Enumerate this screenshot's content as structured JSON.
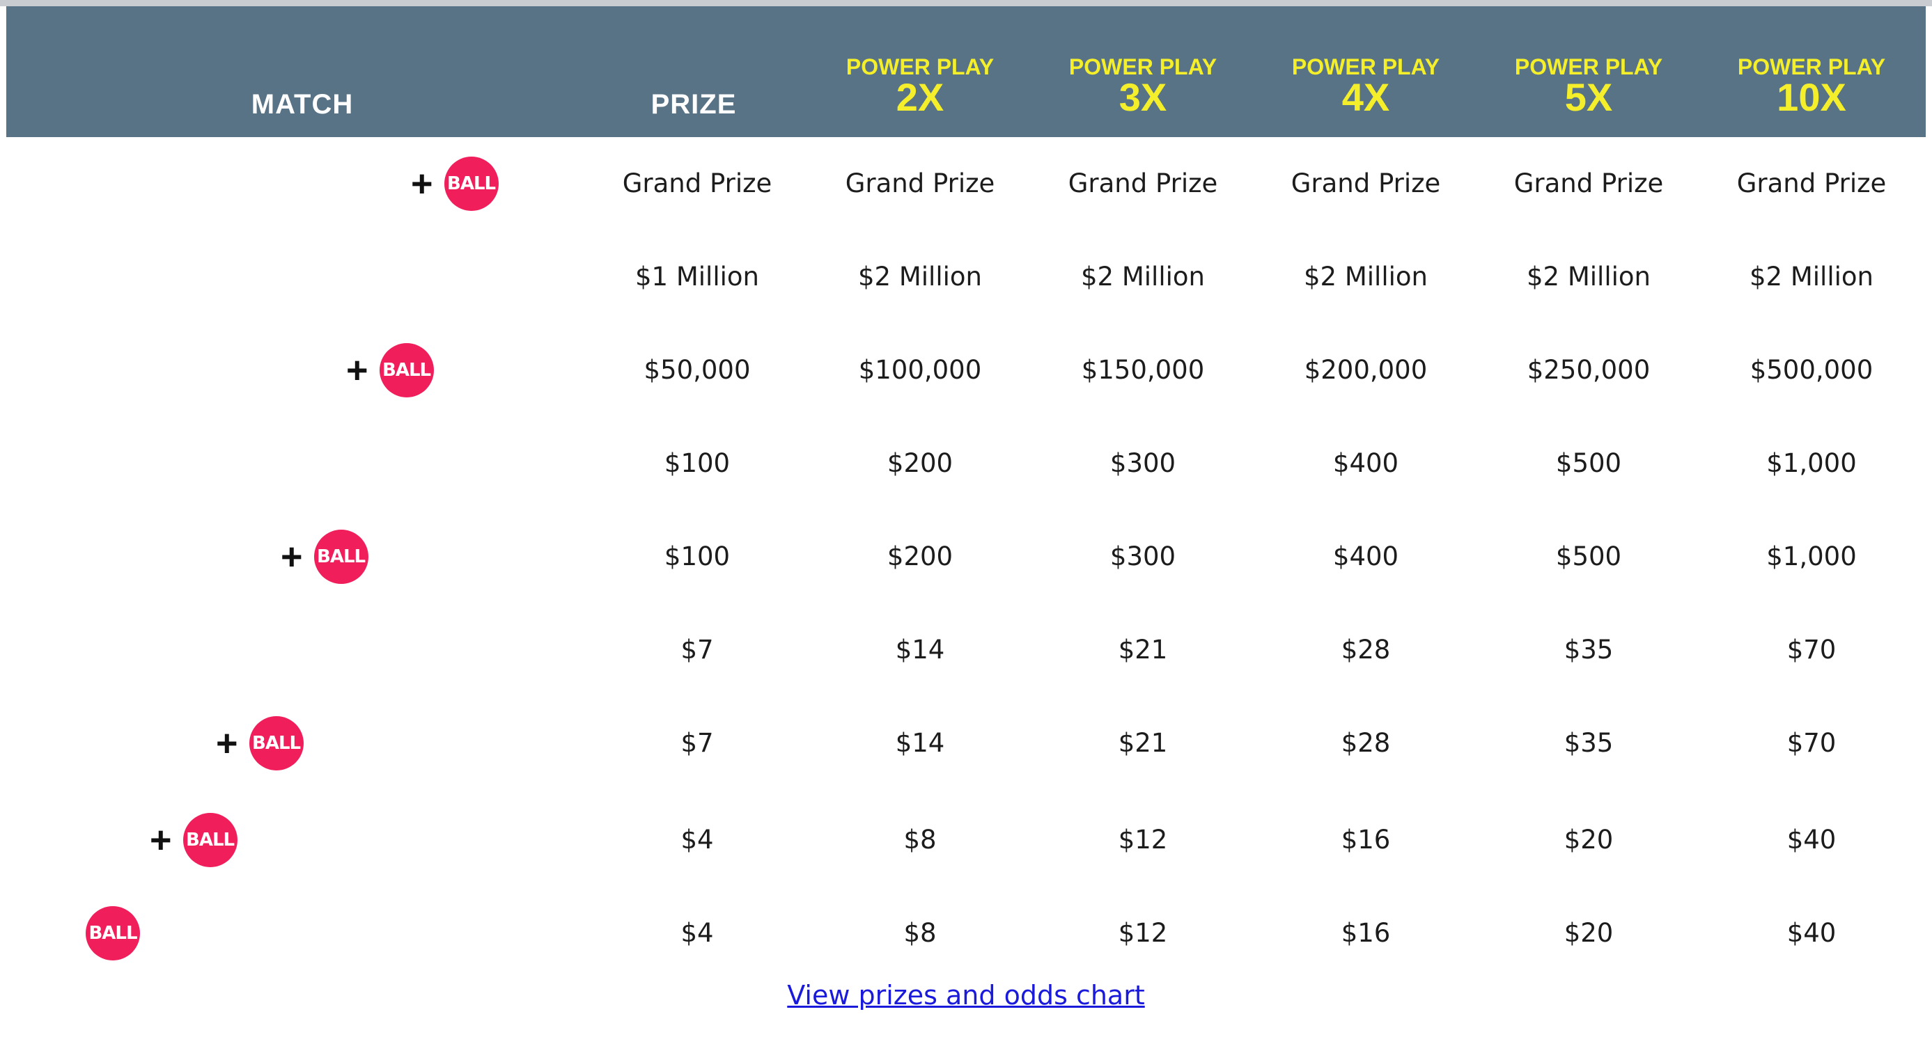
{
  "header": {
    "match_label": "MATCH",
    "prize_label": "PRIZE",
    "power_play": [
      {
        "label": "POWER PLAY",
        "multiplier": "2X"
      },
      {
        "label": "POWER PLAY",
        "multiplier": "3X"
      },
      {
        "label": "POWER PLAY",
        "multiplier": "4X"
      },
      {
        "label": "POWER PLAY",
        "multiplier": "5X"
      },
      {
        "label": "POWER PLAY",
        "multiplier": "10X"
      }
    ]
  },
  "ball_label": "BALL",
  "plus_sign": "+",
  "rows": [
    {
      "has_plus": true,
      "prizes": [
        "Grand Prize",
        "Grand Prize",
        "Grand Prize",
        "Grand Prize",
        "Grand Prize",
        "Grand Prize"
      ]
    },
    {
      "has_plus": false,
      "prizes": [
        "$1 Million",
        "$2 Million",
        "$2 Million",
        "$2 Million",
        "$2 Million",
        "$2 Million"
      ]
    },
    {
      "has_plus": true,
      "prizes": [
        "$50,000",
        "$100,000",
        "$150,000",
        "$200,000",
        "$250,000",
        "$500,000"
      ]
    },
    {
      "has_plus": false,
      "prizes": [
        "$100",
        "$200",
        "$300",
        "$400",
        "$500",
        "$1,000"
      ]
    },
    {
      "has_plus": true,
      "prizes": [
        "$100",
        "$200",
        "$300",
        "$400",
        "$500",
        "$1,000"
      ]
    },
    {
      "has_plus": false,
      "prizes": [
        "$7",
        "$14",
        "$21",
        "$28",
        "$35",
        "$70"
      ]
    },
    {
      "has_plus": true,
      "prizes": [
        "$7",
        "$14",
        "$21",
        "$28",
        "$35",
        "$70"
      ]
    },
    {
      "has_plus": true,
      "prizes": [
        "$4",
        "$8",
        "$12",
        "$16",
        "$20",
        "$40"
      ]
    },
    {
      "has_plus": false,
      "prizes": [
        "$4",
        "$8",
        "$12",
        "$16",
        "$20",
        "$40"
      ]
    }
  ],
  "odds_link": "View prizes and odds chart",
  "colors": {
    "header_bg": "#587386",
    "power_play_yellow": "#f4ef2a",
    "ball_red": "#f01f5c",
    "link_blue": "#1a1adb"
  }
}
